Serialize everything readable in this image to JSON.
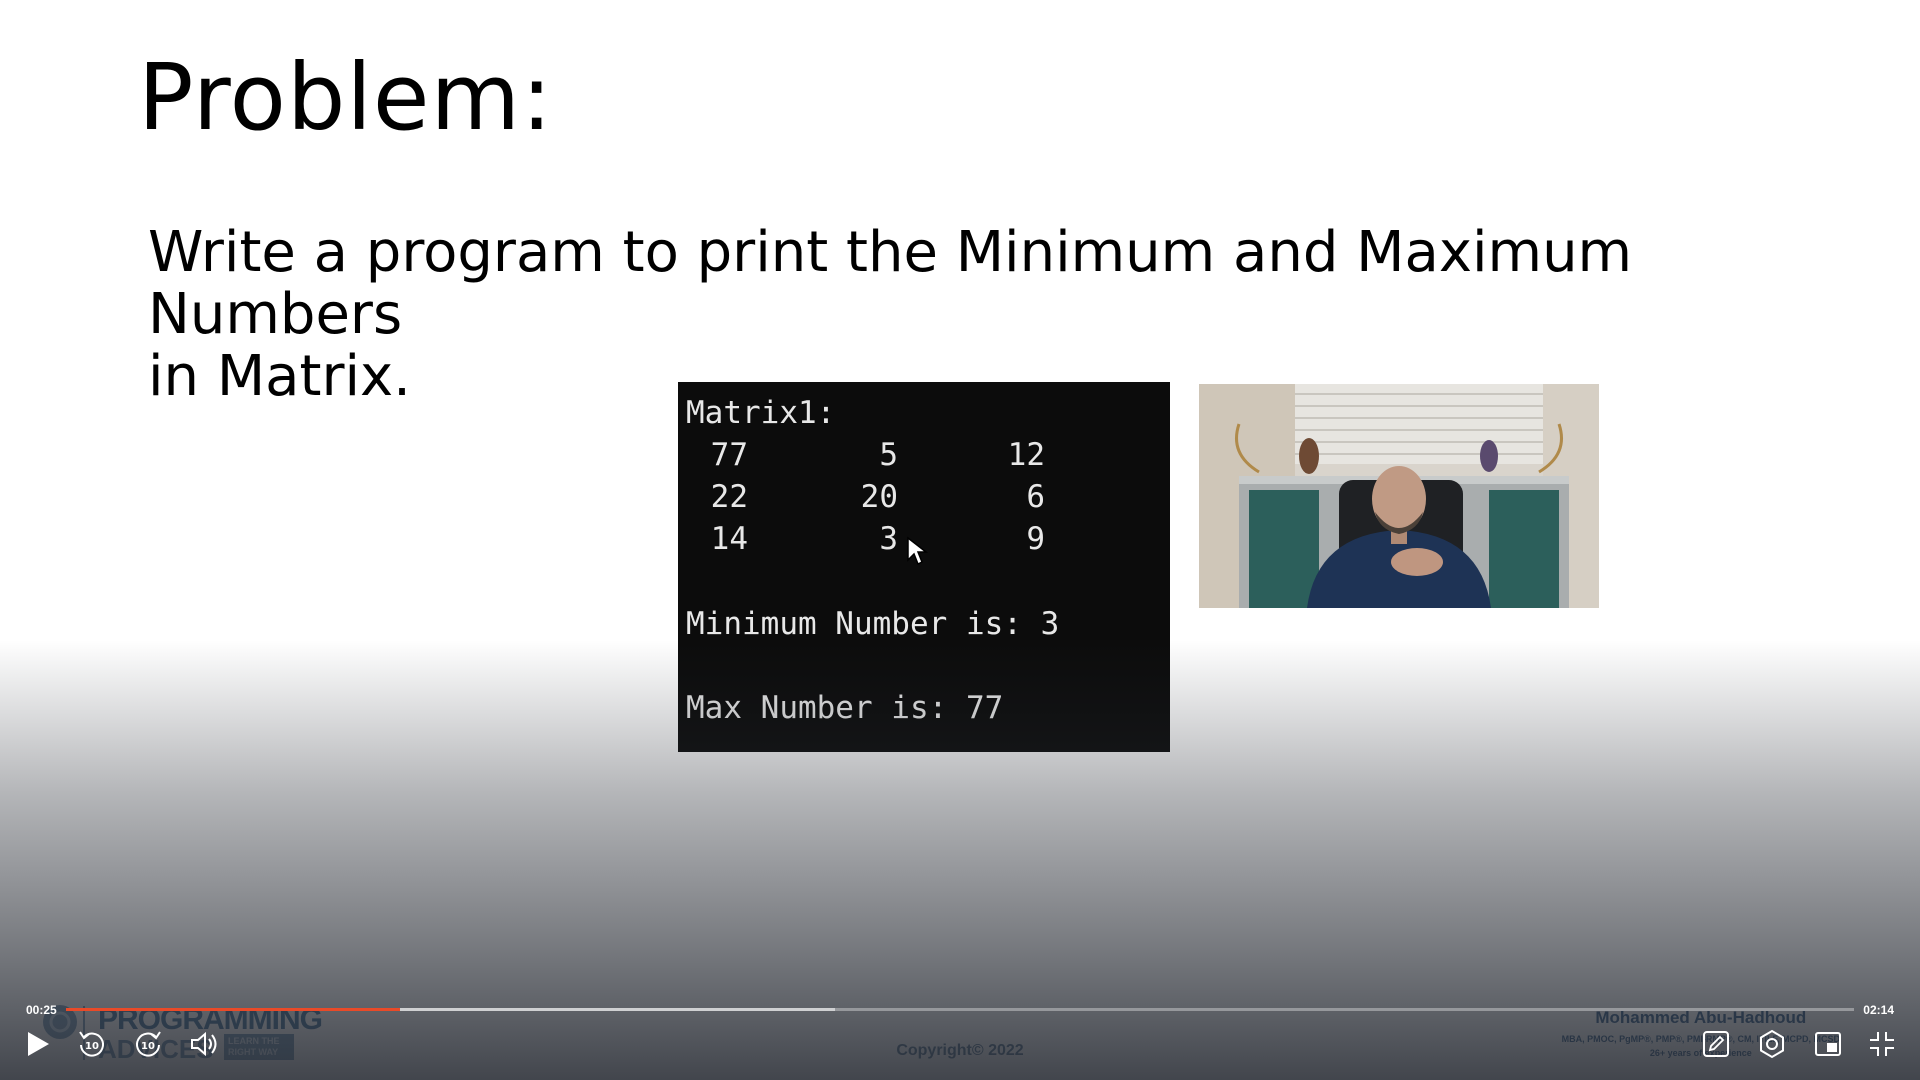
{
  "slide": {
    "title": "Problem:",
    "problem_line1": "Write a program to print the Minimum and Maximum Numbers",
    "problem_line2": "in Matrix."
  },
  "console": {
    "heading": "Matrix1:",
    "matrix": [
      [
        "77",
        "5",
        "12"
      ],
      [
        "22",
        "20",
        "6"
      ],
      [
        "14",
        "3",
        "9"
      ]
    ],
    "min_line": "Minimum Number is: 3",
    "max_line": "Max Number is: 77"
  },
  "branding": {
    "logo_text": "PROGRAMMING",
    "logo_sub": "ADVICES",
    "tagline": "LEARN THE RIGHT WAY",
    "copyright": "Copyright© 2022",
    "author_name": "Mohammed Abu-Hadhoud",
    "author_creds": "MBA, PMOC, PgMP®, PMP®, PMI-RMP®, CM, ITILF, MCPD, MCSD",
    "author_years": "26+ years of experience"
  },
  "player": {
    "current_time": "00:25",
    "total_time": "02:14",
    "progress_fraction": 0.187,
    "buffered_fraction": 0.43,
    "accent_color": "#e94a28",
    "icons": {
      "play": "play-icon",
      "rewind": "rewind-10-icon",
      "forward": "forward-10-icon",
      "volume": "volume-icon",
      "annotate": "pencil-icon",
      "settings": "gear-icon",
      "pip": "picture-in-picture-icon",
      "fullscreen_exit": "exit-fullscreen-icon"
    }
  }
}
